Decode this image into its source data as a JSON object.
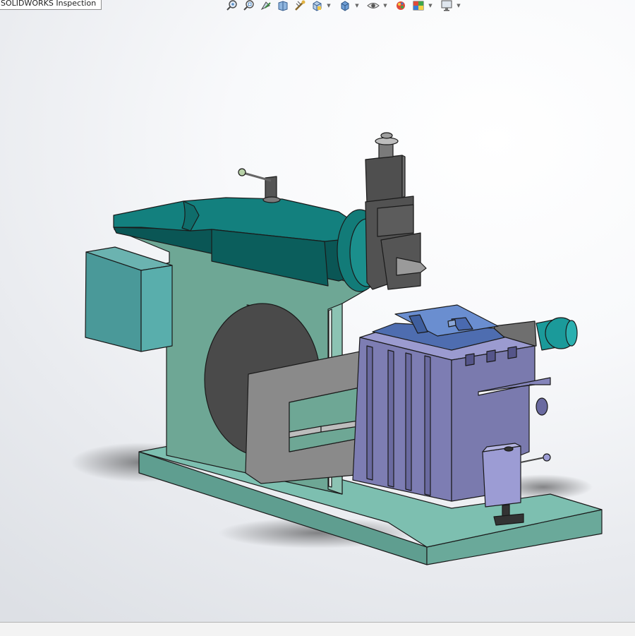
{
  "window": {
    "tab_label": "SOLIDWORKS Inspection"
  },
  "toolbar": {
    "buttons": [
      {
        "icon": "zoom-to-fit-icon"
      },
      {
        "icon": "zoom-to-area-icon"
      },
      {
        "icon": "previous-view-icon"
      },
      {
        "icon": "section-view-icon"
      },
      {
        "icon": "dynamic-annotation-views-icon"
      },
      {
        "icon": "view-orientation-icon",
        "has_dropdown": true
      },
      {
        "icon": "display-style-icon",
        "has_dropdown": true
      },
      {
        "icon": "hide-show-items-icon",
        "has_dropdown": true
      },
      {
        "icon": "edit-appearance-icon"
      },
      {
        "icon": "apply-scene-icon",
        "has_dropdown": true
      },
      {
        "icon": "view-settings-icon",
        "has_dropdown": true
      }
    ]
  },
  "model": {
    "name": "shaper-machine-assembly",
    "colors": {
      "base": "#7dbfb0",
      "column": "#6aa392",
      "ram": "#0f6d6b",
      "motor_box": "#4a9999",
      "bull_gear": "#4a4a4a",
      "tool_head": "#4f4f4f",
      "table": "#7d7db3",
      "vise": "#5a7bb8",
      "crank_bracket": "#8a8a8a",
      "motor": "#1b9a9a"
    }
  }
}
